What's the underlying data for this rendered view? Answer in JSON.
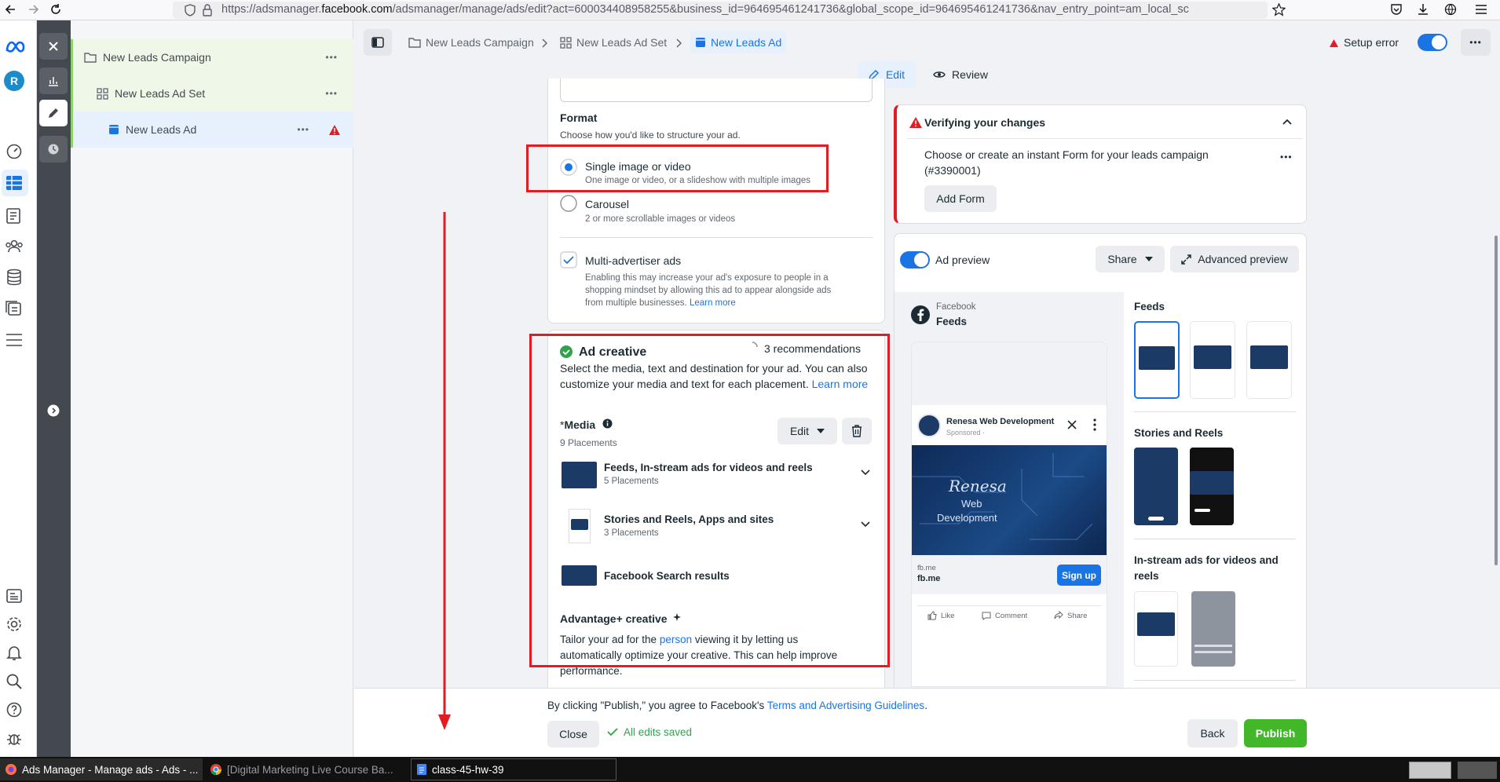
{
  "browser": {
    "url_prefix": "https://adsmanager.",
    "url_domain": "facebook.com",
    "url_rest": "/adsmanager/manage/ads/edit?act=600034408958255&business_id=964695461241736&global_scope_id=964695461241736&nav_entry_point=am_local_sc"
  },
  "rail": {
    "avatar_letter": "R"
  },
  "tree": {
    "campaign": "New Leads Campaign",
    "adset": "New Leads Ad Set",
    "ad": "New Leads Ad",
    "more": "•••"
  },
  "header": {
    "crumbs": [
      "New Leads Campaign",
      "New Leads Ad Set",
      "New Leads Ad"
    ],
    "setup_error": "Setup error",
    "more": "•••",
    "edit_tab": "Edit",
    "review_tab": "Review"
  },
  "format": {
    "title": "Format",
    "subtitle": "Choose how you'd like to structure your ad.",
    "single_title": "Single image or video",
    "single_desc": "One image or video, or a slideshow with multiple images",
    "carousel_title": "Carousel",
    "carousel_desc": "2 or more scrollable images or videos",
    "multi_title": "Multi-advertiser ads",
    "multi_desc_1": "Enabling this may increase your ad's exposure to people in a",
    "multi_desc_2": "shopping mindset by allowing this ad to appear alongside ads",
    "multi_desc_3": "from multiple businesses.",
    "learn_more": "Learn more"
  },
  "creative": {
    "title": "Ad creative",
    "recommendations": "3 recommendations",
    "desc_1": "Select the media, text and destination for your ad. You can also",
    "desc_2": "customize your media and text for each placement.",
    "learn_more": "Learn more",
    "media_label": "Media",
    "media_star": "*",
    "placements": "9 Placements",
    "edit_button": "Edit",
    "groups": [
      {
        "title": "Feeds, In-stream ads for videos and reels",
        "sub": "5 Placements"
      },
      {
        "title": "Stories and Reels, Apps and sites",
        "sub": "3 Placements"
      },
      {
        "title": "Facebook Search results",
        "sub": ""
      }
    ],
    "adv_title": "Advantage+ creative",
    "adv_1": "Tailor your ad for the",
    "adv_person": "person",
    "adv_2": "viewing it by letting us",
    "adv_3": "automatically optimize your creative. This can help improve",
    "adv_4": "performance."
  },
  "verify": {
    "title": "Verifying your changes",
    "message_1": "Choose or create an instant Form for your leads campaign",
    "message_2": "(#3390001)",
    "button": "Add Form",
    "more": "•••"
  },
  "preview": {
    "toggle_label": "Ad preview",
    "share": "Share",
    "advanced": "Advanced preview",
    "platform": "Facebook",
    "placement": "Feeds",
    "page_name": "Renesa Web Development",
    "sponsored": "Sponsored · ",
    "image_line1": "Renesa",
    "image_line2": "Web",
    "image_line3": "Development",
    "domain_small": "fb.me",
    "domain": "fb.me",
    "cta": "Sign up",
    "like": "Like",
    "comment": "Comment",
    "share_action": "Share",
    "sections": [
      "Feeds",
      "Stories and Reels",
      "In-stream ads for videos and reels"
    ]
  },
  "footer": {
    "agree_text": "By clicking \"Publish,\" you agree to Facebook's",
    "terms_link": "Terms and Advertising Guidelines",
    "period": ".",
    "close": "Close",
    "saved": "All edits saved",
    "back": "Back",
    "publish": "Publish"
  },
  "taskbar": {
    "items": [
      "Ads Manager - Manage ads - Ads - ...",
      "[Digital Marketing Live Course Ba...",
      "class-45-hw-39"
    ]
  },
  "colors": {
    "accent": "#1b74e4",
    "publish": "#42b72a",
    "error": "#e31b23",
    "annotation": "#e31b23"
  }
}
